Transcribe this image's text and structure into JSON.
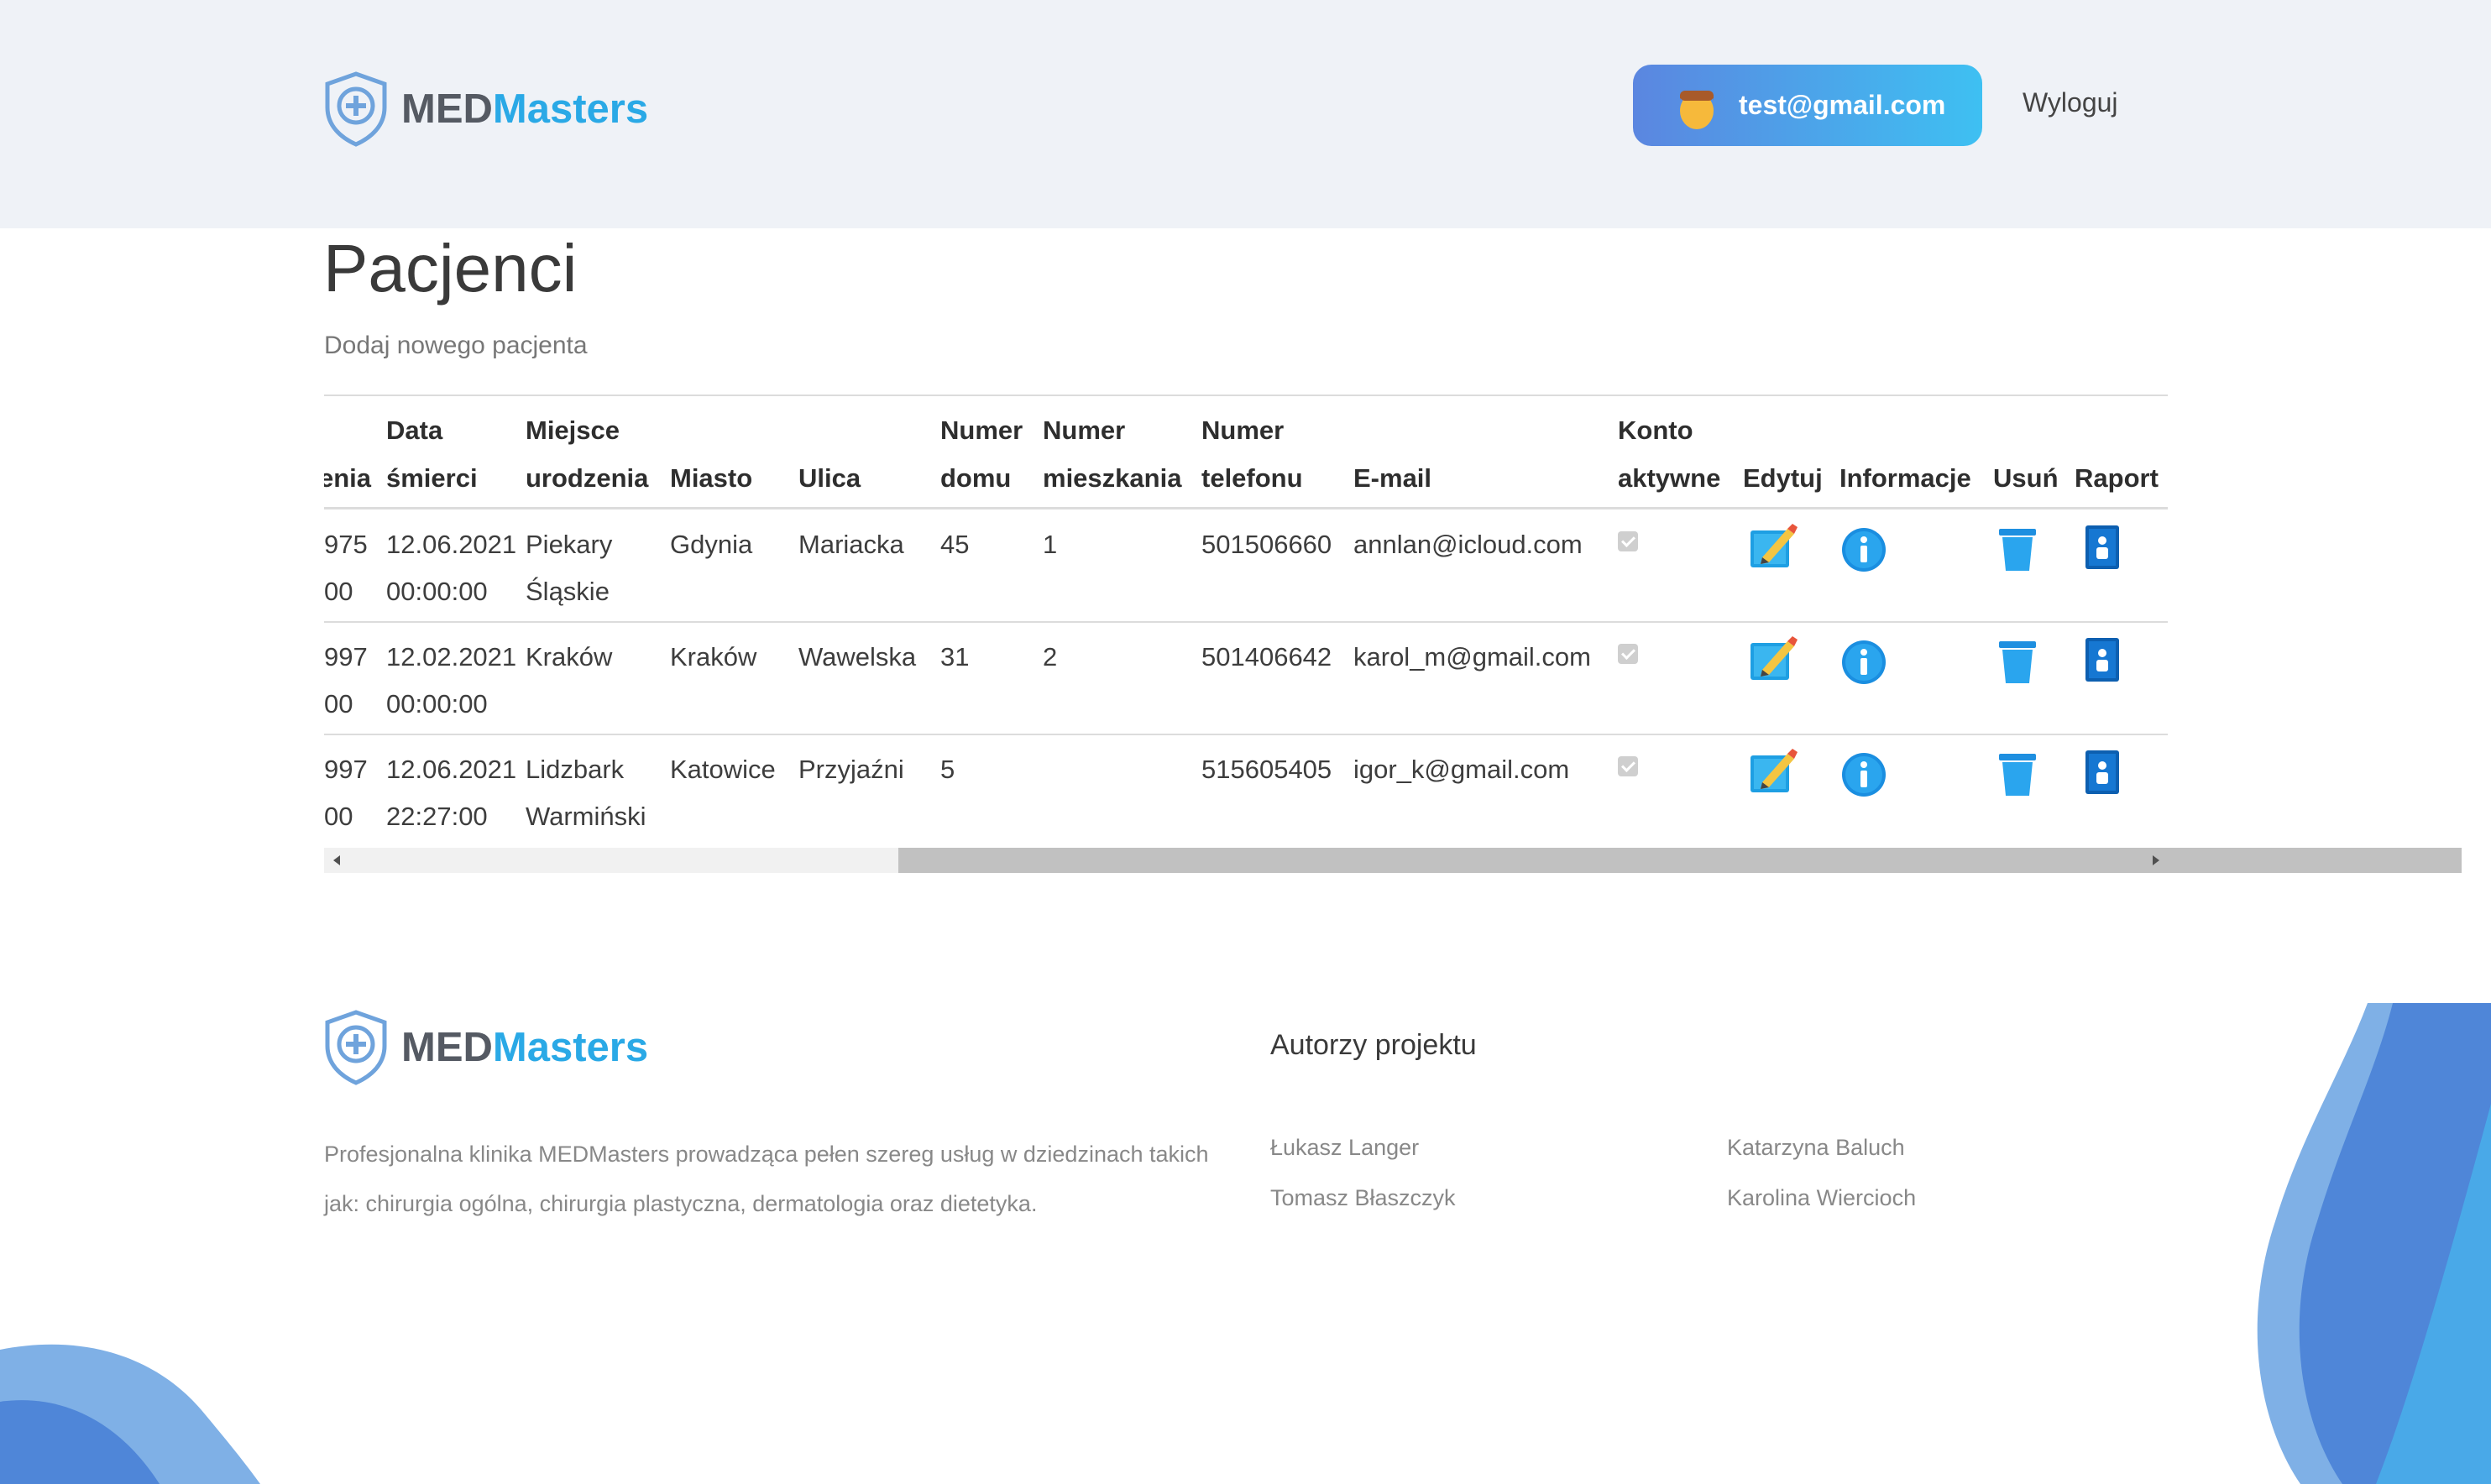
{
  "header": {
    "logo": {
      "part1": "MED",
      "part2": "Masters"
    },
    "user_email": "test@gmail.com",
    "logout_label": "Wyloguj"
  },
  "main": {
    "title": "Pacjenci",
    "add_link": "Dodaj nowego pacjenta",
    "table": {
      "headers": [
        {
          "line1": "",
          "line2": "enia"
        },
        {
          "line1": "Data",
          "line2": "śmierci"
        },
        {
          "line1": "Miejsce",
          "line2": "urodzenia"
        },
        {
          "line1": "",
          "line2": "Miasto"
        },
        {
          "line1": "",
          "line2": "Ulica"
        },
        {
          "line1": "Numer",
          "line2": "domu"
        },
        {
          "line1": "Numer",
          "line2": "mieszkania"
        },
        {
          "line1": "Numer",
          "line2": "telefonu"
        },
        {
          "line1": "",
          "line2": "E-mail"
        },
        {
          "line1": "Konto",
          "line2": "aktywne"
        },
        {
          "line1": "",
          "line2": "Edytuj"
        },
        {
          "line1": "",
          "line2": "Informacje"
        },
        {
          "line1": "",
          "line2": "Usuń"
        },
        {
          "line1": "",
          "line2": "Raport"
        }
      ],
      "rows": [
        {
          "birth_date": [
            "975",
            "00"
          ],
          "death_date": [
            "12.06.2021",
            "00:00:00"
          ],
          "birth_place": [
            "Piekary",
            "Śląskie"
          ],
          "city": "Gdynia",
          "street": "Mariacka",
          "house_no": "45",
          "apt_no": "1",
          "phone": "501506660",
          "email": "annlan@icloud.com",
          "active": true
        },
        {
          "birth_date": [
            "997",
            "00"
          ],
          "death_date": [
            "12.02.2021",
            "00:00:00"
          ],
          "birth_place": [
            "Kraków",
            ""
          ],
          "city": "Kraków",
          "street": "Wawelska",
          "house_no": "31",
          "apt_no": "2",
          "phone": "501406642",
          "email": "karol_m@gmail.com",
          "active": true
        },
        {
          "birth_date": [
            "997",
            "00"
          ],
          "death_date": [
            "12.06.2021",
            "22:27:00"
          ],
          "birth_place": [
            "Lidzbark",
            "Warmiński"
          ],
          "city": "Katowice",
          "street": "Przyjaźni",
          "house_no": "5",
          "apt_no": "",
          "phone": "515605405",
          "email": "igor_k@gmail.com",
          "active": true
        }
      ],
      "icons": {
        "edit": "edit-pencil-icon",
        "info": "info-icon",
        "delete": "trash-icon",
        "report": "report-icon"
      }
    }
  },
  "footer": {
    "logo": {
      "part1": "MED",
      "part2": "Masters"
    },
    "description": "Profesjonalna klinika MEDMasters prowadząca pełen szereg usług w dziedzinach takich jak: chirurgia ogólna, chirurgia plastyczna, dermatologia oraz dietetyka.",
    "authors_heading": "Autorzy projektu",
    "authors": [
      "Łukasz Langer",
      "Katarzyna Baluch",
      "Tomasz Błaszczyk",
      "Karolina Wiercioch"
    ]
  },
  "colors": {
    "header_bg": "#eff2f7",
    "brand_blue": "#2aa9e6",
    "brand_gray": "#555a63",
    "pill_start": "#5b86e0",
    "pill_end": "#3ec0f2",
    "blob": "#4a7fd6"
  }
}
